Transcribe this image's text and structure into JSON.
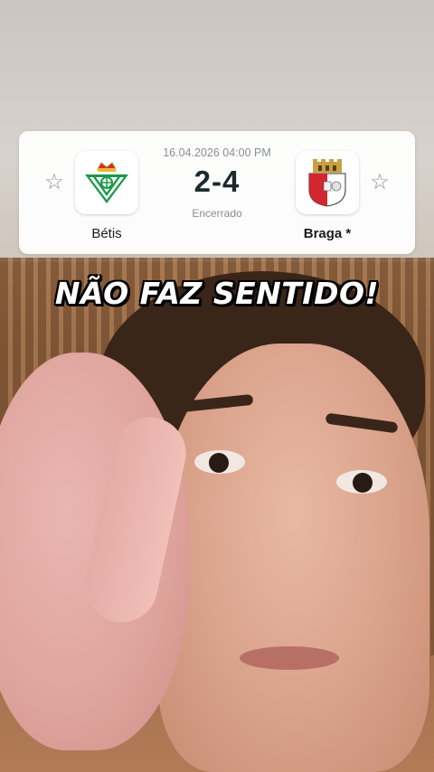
{
  "match": {
    "datetime": "16.04.2026 04:00 PM",
    "score": "2-4",
    "status": "Encerrado",
    "home": {
      "name": "Bétis",
      "logo_icon": "real-betis-crest-icon",
      "color": "#1a9a4a"
    },
    "away": {
      "name": "Braga *",
      "logo_icon": "sc-braga-crest-icon",
      "color": "#d22630"
    }
  },
  "caption": "NÃO FAZ SENTIDO!",
  "colors": {
    "card_bg": "#ffffff",
    "score_text": "#1d2a2d",
    "muted_text": "#8a8d93"
  }
}
